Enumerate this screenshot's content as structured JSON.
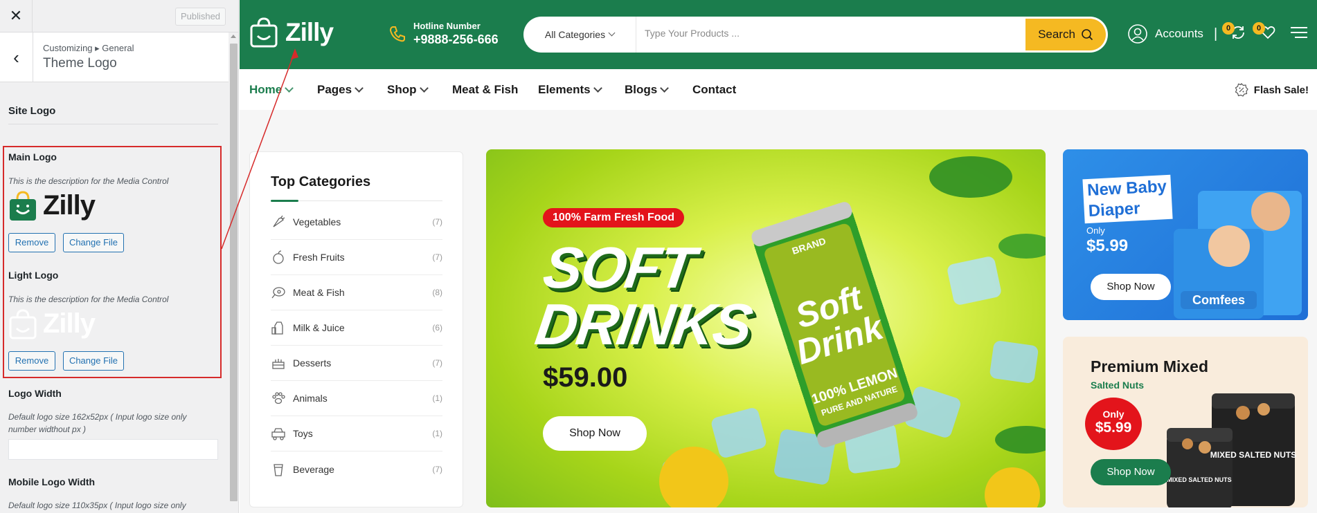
{
  "customizer": {
    "close_icon": "close-icon",
    "published_label": "Published",
    "breadcrumb": "Customizing ▸ General",
    "section_title": "Theme Logo",
    "site_logo_heading": "Site Logo",
    "main_logo": {
      "label": "Main Logo",
      "description": "This is the description for the Media Control",
      "preview_text": "Zilly",
      "remove_label": "Remove",
      "change_label": "Change File"
    },
    "light_logo": {
      "label": "Light Logo",
      "description": "This is the description for the Media Control",
      "preview_text": "Zilly",
      "remove_label": "Remove",
      "change_label": "Change File"
    },
    "logo_width": {
      "label": "Logo Width",
      "description": "Default logo size 162x52px ( Input logo size only number widthout px )",
      "value": ""
    },
    "mobile_logo_width": {
      "label": "Mobile Logo Width",
      "description": "Default logo size 110x35px ( Input logo size only"
    }
  },
  "store": {
    "brand": "Zilly",
    "hotline_label": "Hotline Number",
    "hotline_number": "+9888-256-666",
    "search": {
      "category": "All Categories",
      "placeholder": "Type Your Products ...",
      "button": "Search"
    },
    "accounts_label": "Accounts",
    "separator": "|",
    "compare_count": "0",
    "wishlist_count": "0",
    "nav": [
      "Home",
      "Pages",
      "Shop",
      "Meat & Fish",
      "Elements",
      "Blogs",
      "Contact"
    ],
    "flash_sale": "Flash Sale!",
    "categories": {
      "title": "Top Categories",
      "items": [
        {
          "name": "Vegetables",
          "count": "(7)"
        },
        {
          "name": "Fresh Fruits",
          "count": "(7)"
        },
        {
          "name": "Meat & Fish",
          "count": "(8)"
        },
        {
          "name": "Milk & Juice",
          "count": "(6)"
        },
        {
          "name": "Desserts",
          "count": "(7)"
        },
        {
          "name": "Animals",
          "count": "(1)"
        },
        {
          "name": "Toys",
          "count": "(1)"
        },
        {
          "name": "Beverage",
          "count": "(7)"
        }
      ]
    },
    "hero": {
      "badge": "100% Farm Fresh Food",
      "title_line1": "SOFT",
      "title_line2": "DRINKS",
      "price": "$59.00",
      "button": "Shop Now",
      "can_text1": "Soft",
      "can_text2": "Drink",
      "can_brand": "BRAND",
      "can_lemon": "100% LEMON",
      "can_pure": "PURE AND NATURE"
    },
    "promo_diaper": {
      "title_line1": "New Baby",
      "title_line2": "Diaper",
      "only": "Only",
      "price": "$5.99",
      "button": "Shop Now",
      "brand": "Comfees"
    },
    "promo_nuts": {
      "title": "Premium Mixed",
      "subtitle": "Salted Nuts",
      "only": "Only",
      "price": "$5.99",
      "button": "Shop Now",
      "jar_label1": "MIXED SALTED NUTS",
      "jar_label2": "MIXED SALTED NUTS"
    }
  },
  "colors": {
    "brand_green": "#1b7d4d",
    "accent_yellow": "#f5b922",
    "sale_red": "#e3141b",
    "wp_blue": "#2271b1"
  }
}
